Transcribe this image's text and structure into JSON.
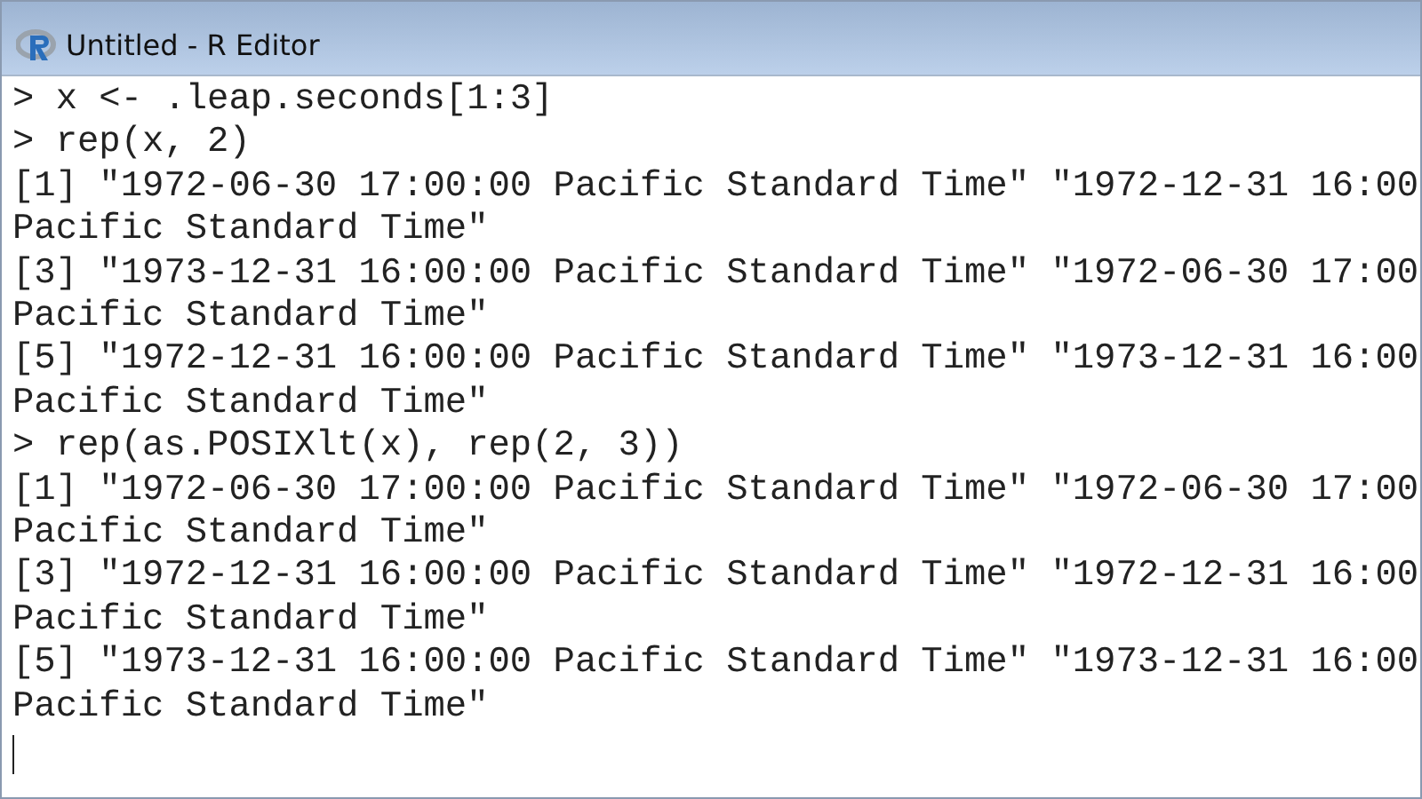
{
  "window": {
    "title": "Untitled - R Editor"
  },
  "lines": [
    "> x <- .leap.seconds[1:3]",
    "> rep(x, 2)",
    "[1] \"1972-06-30 17:00:00 Pacific Standard Time\" \"1972-12-31 16:00",
    "Pacific Standard Time\"",
    "[3] \"1973-12-31 16:00:00 Pacific Standard Time\" \"1972-06-30 17:00",
    "Pacific Standard Time\"",
    "[5] \"1972-12-31 16:00:00 Pacific Standard Time\" \"1973-12-31 16:00",
    "Pacific Standard Time\"",
    "> rep(as.POSIXlt(x), rep(2, 3))",
    "[1] \"1972-06-30 17:00:00 Pacific Standard Time\" \"1972-06-30 17:00",
    "Pacific Standard Time\"",
    "[3] \"1972-12-31 16:00:00 Pacific Standard Time\" \"1972-12-31 16:00",
    "Pacific Standard Time\"",
    "[5] \"1973-12-31 16:00:00 Pacific Standard Time\" \"1973-12-31 16:00",
    "Pacific Standard Time\""
  ]
}
